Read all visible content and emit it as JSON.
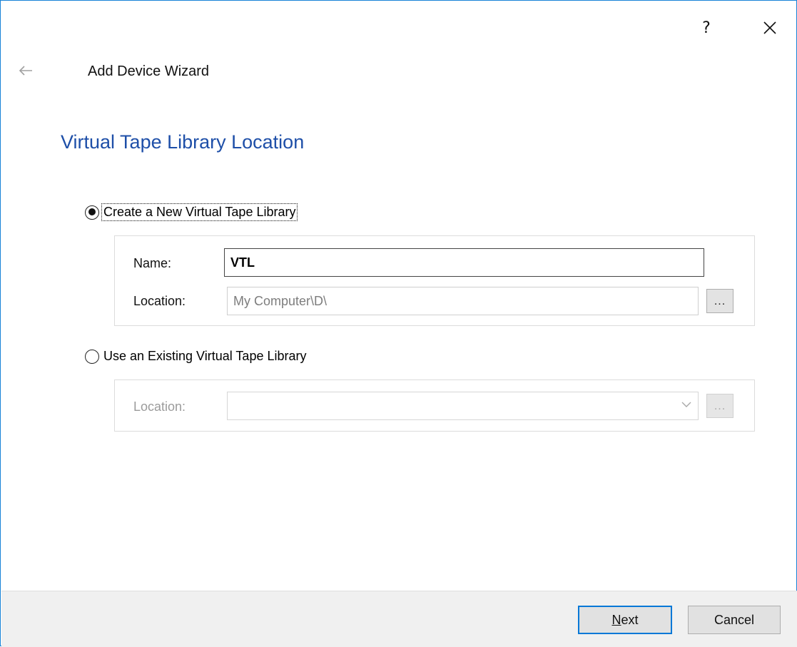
{
  "titlebar": {
    "help_label": "?",
    "close_icon": "close-icon"
  },
  "header": {
    "back_icon": "back-arrow-icon",
    "wizard_title": "Add Device Wizard"
  },
  "page": {
    "heading": "Virtual Tape Library Location"
  },
  "options": {
    "create_new": {
      "label": "Create a New Virtual Tape Library",
      "selected": true,
      "name_label": "Name:",
      "name_value": "VTL",
      "location_label": "Location:",
      "location_value": "My Computer\\D\\",
      "browse_label": "..."
    },
    "use_existing": {
      "label": "Use an Existing Virtual Tape Library",
      "selected": false,
      "location_label": "Location:",
      "location_value": "",
      "browse_label": "..."
    }
  },
  "footer": {
    "next_label": "Next",
    "cancel_label": "Cancel"
  },
  "colors": {
    "accent": "#0078d7",
    "heading": "#1e4fa8",
    "footer_bg": "#f0f0f0"
  }
}
